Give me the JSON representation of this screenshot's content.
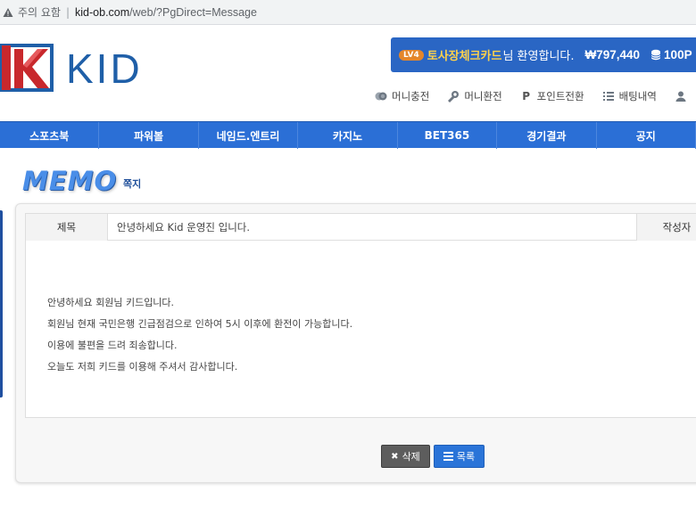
{
  "browser": {
    "security_label": "주의 요함",
    "url_host": "kid-ob.com",
    "url_path": "/web/?PgDirect=Message"
  },
  "header": {
    "logo_text": "KID",
    "level_badge": "LV4",
    "username": "토사장체크카드",
    "greeting": "님 환영합니다.",
    "money": "₩797,440",
    "points": "100P",
    "quicklinks": [
      {
        "label": "머니충전",
        "icon": "coin-stack-icon"
      },
      {
        "label": "머니환전",
        "icon": "exchange-icon"
      },
      {
        "label": "포인트전환",
        "icon": "point-p-icon"
      },
      {
        "label": "배팅내역",
        "icon": "list-icon"
      },
      {
        "label": "",
        "icon": "user-icon"
      }
    ]
  },
  "nav": {
    "items": [
      "스포츠북",
      "파워볼",
      "네임드.엔트리",
      "카지노",
      "BET365",
      "경기결과",
      "공지"
    ]
  },
  "memo": {
    "title": "MEMO",
    "subtitle": "쪽지",
    "subject_label": "제목",
    "subject": "안녕하세요 Kid 운영진 입니다.",
    "author_label": "작성자",
    "body": [
      "안녕하세요 회원님 키드입니다.",
      "회원님 현재 국민은행 긴급점검으로 인하여 5시 이후에 환전이 가능합니다.",
      "이용에 불편을 드려 죄송합니다.",
      "오늘도 저희 키드를 이용해 주셔서 감사합니다."
    ],
    "delete_label": "삭제",
    "list_label": "목록"
  },
  "colors": {
    "nav_blue": "#2b6fd6",
    "welcome_blue": "#2a66c4",
    "username_yellow": "#ffd24a",
    "delete_gray": "#5d5d5d"
  }
}
